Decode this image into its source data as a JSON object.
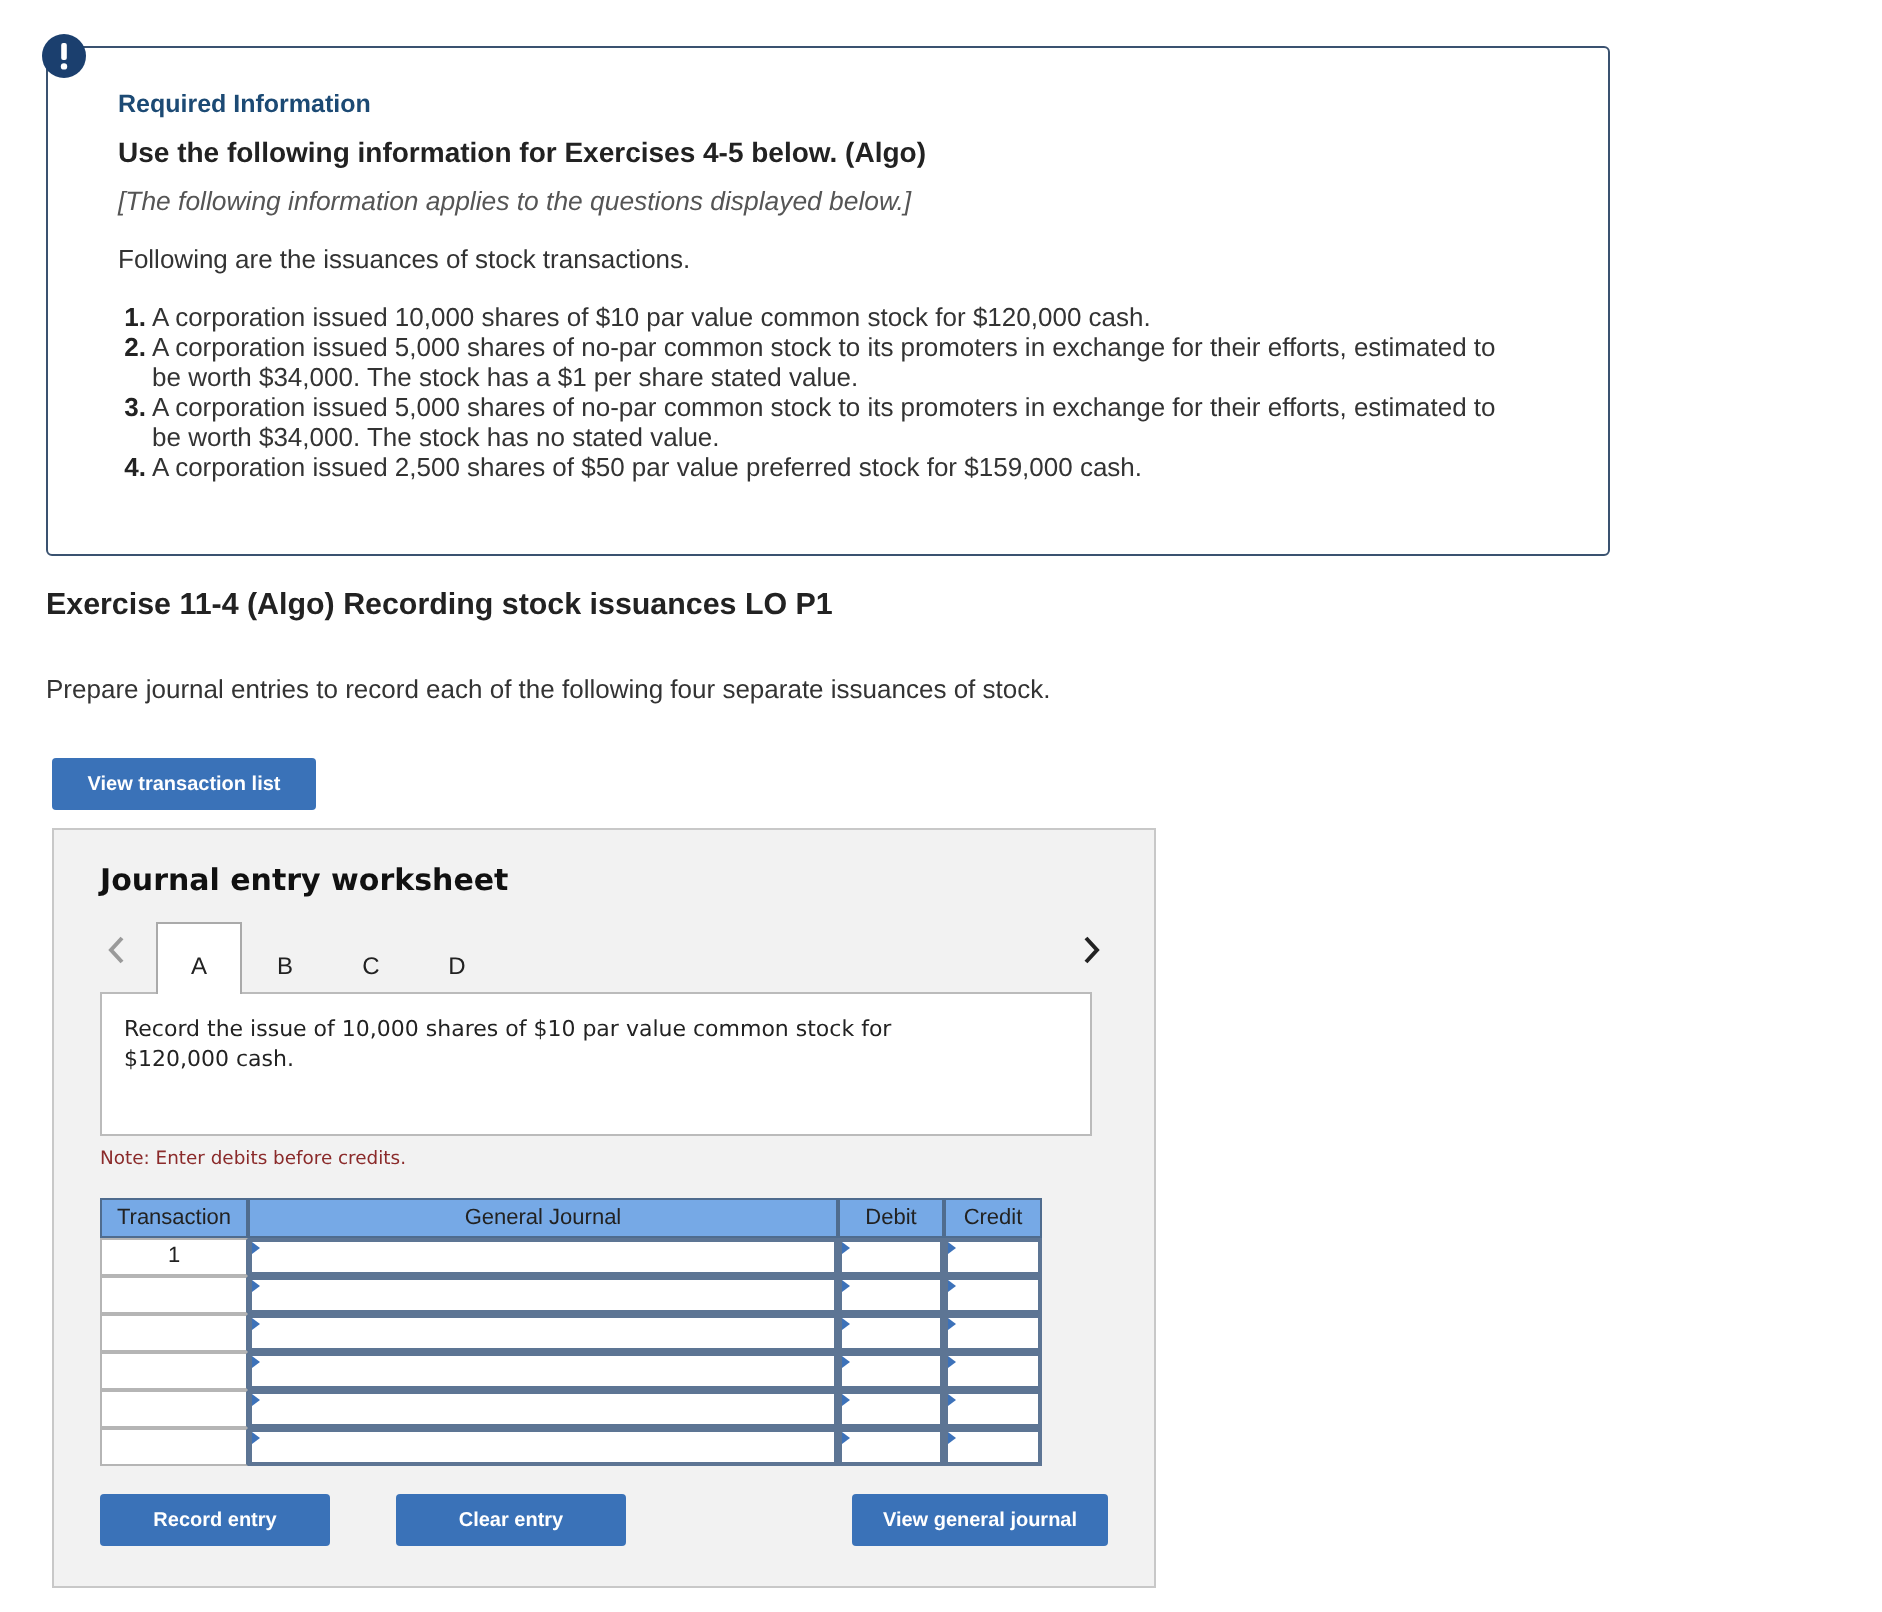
{
  "notice": {
    "heading": "Required Information",
    "title": "Use the following information for Exercises 4-5 below. (Algo)",
    "subtitle": "[The following information applies to the questions displayed below.]",
    "intro": "Following are the issuances of stock transactions.",
    "items": [
      {
        "number": "1.",
        "text": "A corporation issued 10,000 shares of $10 par value common stock for $120,000 cash."
      },
      {
        "number": "2.",
        "text": "A corporation issued 5,000 shares of no-par common stock to its promoters in exchange for their efforts, estimated to be worth $34,000. The stock has a $1 per share stated value."
      },
      {
        "number": "3.",
        "text": "A corporation issued 5,000 shares of no-par common stock to its promoters in exchange for their efforts, estimated to be worth $34,000. The stock has no stated value."
      },
      {
        "number": "4.",
        "text": "A corporation issued 2,500 shares of $50 par value preferred stock for $159,000 cash."
      }
    ]
  },
  "exercise": {
    "title": "Exercise 11-4 (Algo) Recording stock issuances LO P1",
    "instructions": "Prepare journal entries to record each of the following four separate issuances of stock.",
    "button": "View transaction list"
  },
  "worksheet": {
    "title": "Journal entry worksheet",
    "prev": {
      "disabled": true
    },
    "next": {
      "disabled": false
    },
    "tabs": [
      {
        "label": "A",
        "selected": true
      },
      {
        "label": "B",
        "selected": false
      },
      {
        "label": "C",
        "selected": false
      },
      {
        "label": "D",
        "selected": false
      }
    ],
    "description": "Record the issue of 10,000 shares of $10 par value common stock for $120,000 cash.",
    "note": "Note: Enter debits before credits.",
    "table": {
      "columns": [
        "Transaction",
        "General Journal",
        "Debit",
        "Credit"
      ],
      "rows": [
        {
          "transaction": "1"
        },
        {},
        {},
        {},
        {},
        {}
      ]
    },
    "buttons": [
      "Record entry",
      "Clear entry",
      "View general journal"
    ]
  }
}
